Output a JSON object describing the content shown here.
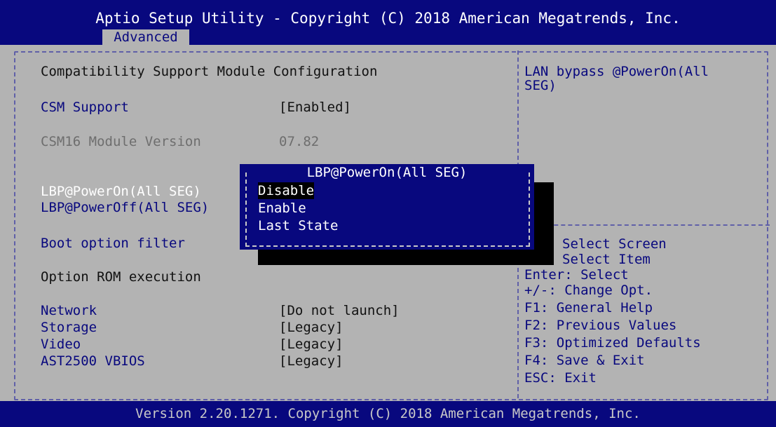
{
  "header": {
    "title": "Aptio Setup Utility - Copyright (C) 2018 American Megatrends, Inc.",
    "tabs": [
      {
        "label": "Advanced",
        "active": true
      }
    ]
  },
  "main": {
    "section_title": "Compatibility Support Module Configuration",
    "csm_support": {
      "label": "CSM Support",
      "value": "[Enabled]"
    },
    "csm16_version": {
      "label": "CSM16 Module Version",
      "value": "07.82"
    },
    "lbp_poweron": {
      "label": "LBP@PowerOn(All SEG)"
    },
    "lbp_poweroff": {
      "label": "LBP@PowerOff(All SEG)"
    },
    "boot_option_filter": {
      "label": "Boot option filter"
    },
    "option_rom_execution": {
      "label": "Option ROM execution"
    },
    "items": [
      {
        "label": "Network",
        "value": "[Do not launch]"
      },
      {
        "label": "Storage",
        "value": "[Legacy]"
      },
      {
        "label": "Video",
        "value": "[Legacy]"
      },
      {
        "label": "AST2500 VBIOS",
        "value": "[Legacy]"
      }
    ]
  },
  "popup": {
    "title": "LBP@PowerOn(All SEG)",
    "options": [
      "Disable",
      "Enable",
      "Last State"
    ],
    "selected": "Disable"
  },
  "help": {
    "description_line1": "LAN bypass @PowerOn(All",
    "description_line2": "SEG)",
    "keys": [
      "Select Screen",
      "Select Item",
      "Enter: Select",
      "+/-: Change Opt.",
      "F1: General Help",
      "F2: Previous Values",
      "F3: Optimized Defaults",
      "F4: Save & Exit",
      "ESC: Exit"
    ]
  },
  "footer": {
    "text": "Version 2.20.1271. Copyright (C) 2018 American Megatrends, Inc."
  },
  "colors": {
    "bios_blue": "#08087e",
    "background_gray": "#b3b3b3",
    "highlight_white": "#ffffff",
    "disabled_gray": "#6e6e6e"
  }
}
